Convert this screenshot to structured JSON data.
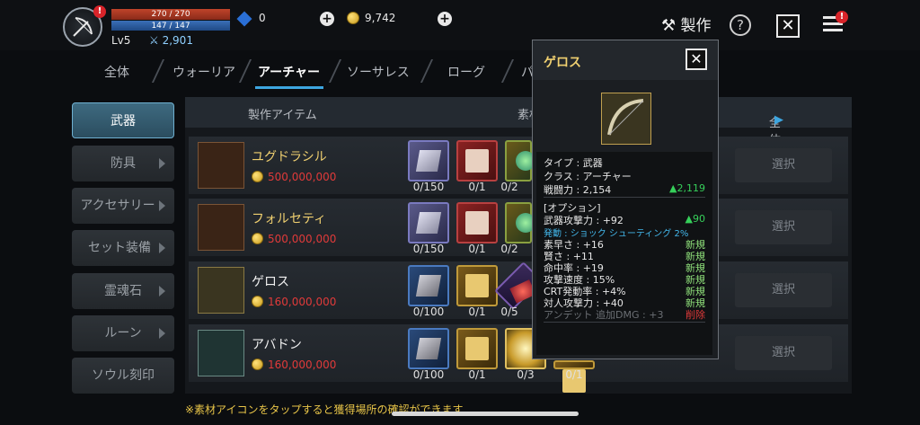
{
  "player": {
    "hp": "270 / 270",
    "mp": "147 / 147",
    "level": "Lv5",
    "combat_power": "2,901",
    "gems": "0",
    "gold": "9,742"
  },
  "header": {
    "craft_label": "製作",
    "help_label": "?",
    "close_label": "✕"
  },
  "tabs": [
    "全体",
    "ウォーリア",
    "アーチャー",
    "ソーサレス",
    "ローグ",
    "パ"
  ],
  "active_tab": "アーチャー",
  "categories": [
    "武器",
    "防具",
    "アクセサリー",
    "セット装備",
    "霊魂石",
    "ルーン",
    "ソウル刻印"
  ],
  "list": {
    "col_item": "製作アイテム",
    "col_material": "素材",
    "filter_label": "全体",
    "select_label": "選択",
    "rows": [
      {
        "name": "ユグドラシル",
        "price": "500,000,000",
        "mats": [
          "0/150",
          "0/1",
          "0/2"
        ]
      },
      {
        "name": "フォルセティ",
        "price": "500,000,000",
        "mats": [
          "0/150",
          "0/1",
          "0/2"
        ]
      },
      {
        "name": "ゲロス",
        "price": "160,000,000",
        "mats": [
          "0/100",
          "0/1",
          "0/5"
        ]
      },
      {
        "name": "アバドン",
        "price": "160,000,000",
        "mats": [
          "0/100",
          "0/1",
          "0/3",
          "0/1"
        ]
      }
    ]
  },
  "tooltip": {
    "title": "ゲロス",
    "type": "タイプ : 武器",
    "class": "クラス : アーチャー",
    "power": "戦闘力 : 2,154",
    "power_diff": "▲2,119",
    "option_header": "[オプション]",
    "weapon_atk": "武器攻撃力 : +92",
    "weapon_atk_diff": "▲90",
    "trigger": "発動 : ショック シューティング 2%",
    "stats": [
      {
        "label": "素早さ : +16",
        "tag": "新規"
      },
      {
        "label": "賢さ : +11",
        "tag": "新規"
      },
      {
        "label": "命中率 : +19",
        "tag": "新規"
      },
      {
        "label": "攻撃速度 : 15%",
        "tag": "新規"
      },
      {
        "label": "CRT発動率 : +4%",
        "tag": "新規"
      },
      {
        "label": "対人攻撃力 : +40",
        "tag": "新規"
      }
    ],
    "removed_stat": "アンデット 追加DMG : +3",
    "removed_tag": "削除"
  },
  "footnote": "※素材アイコンをタップすると獲得場所の確認ができます",
  "colors": {
    "accent": "#3da6e0",
    "item_name_gold": "#f0d070",
    "price_red": "#e03a3a",
    "increase_green": "#36d05a"
  }
}
